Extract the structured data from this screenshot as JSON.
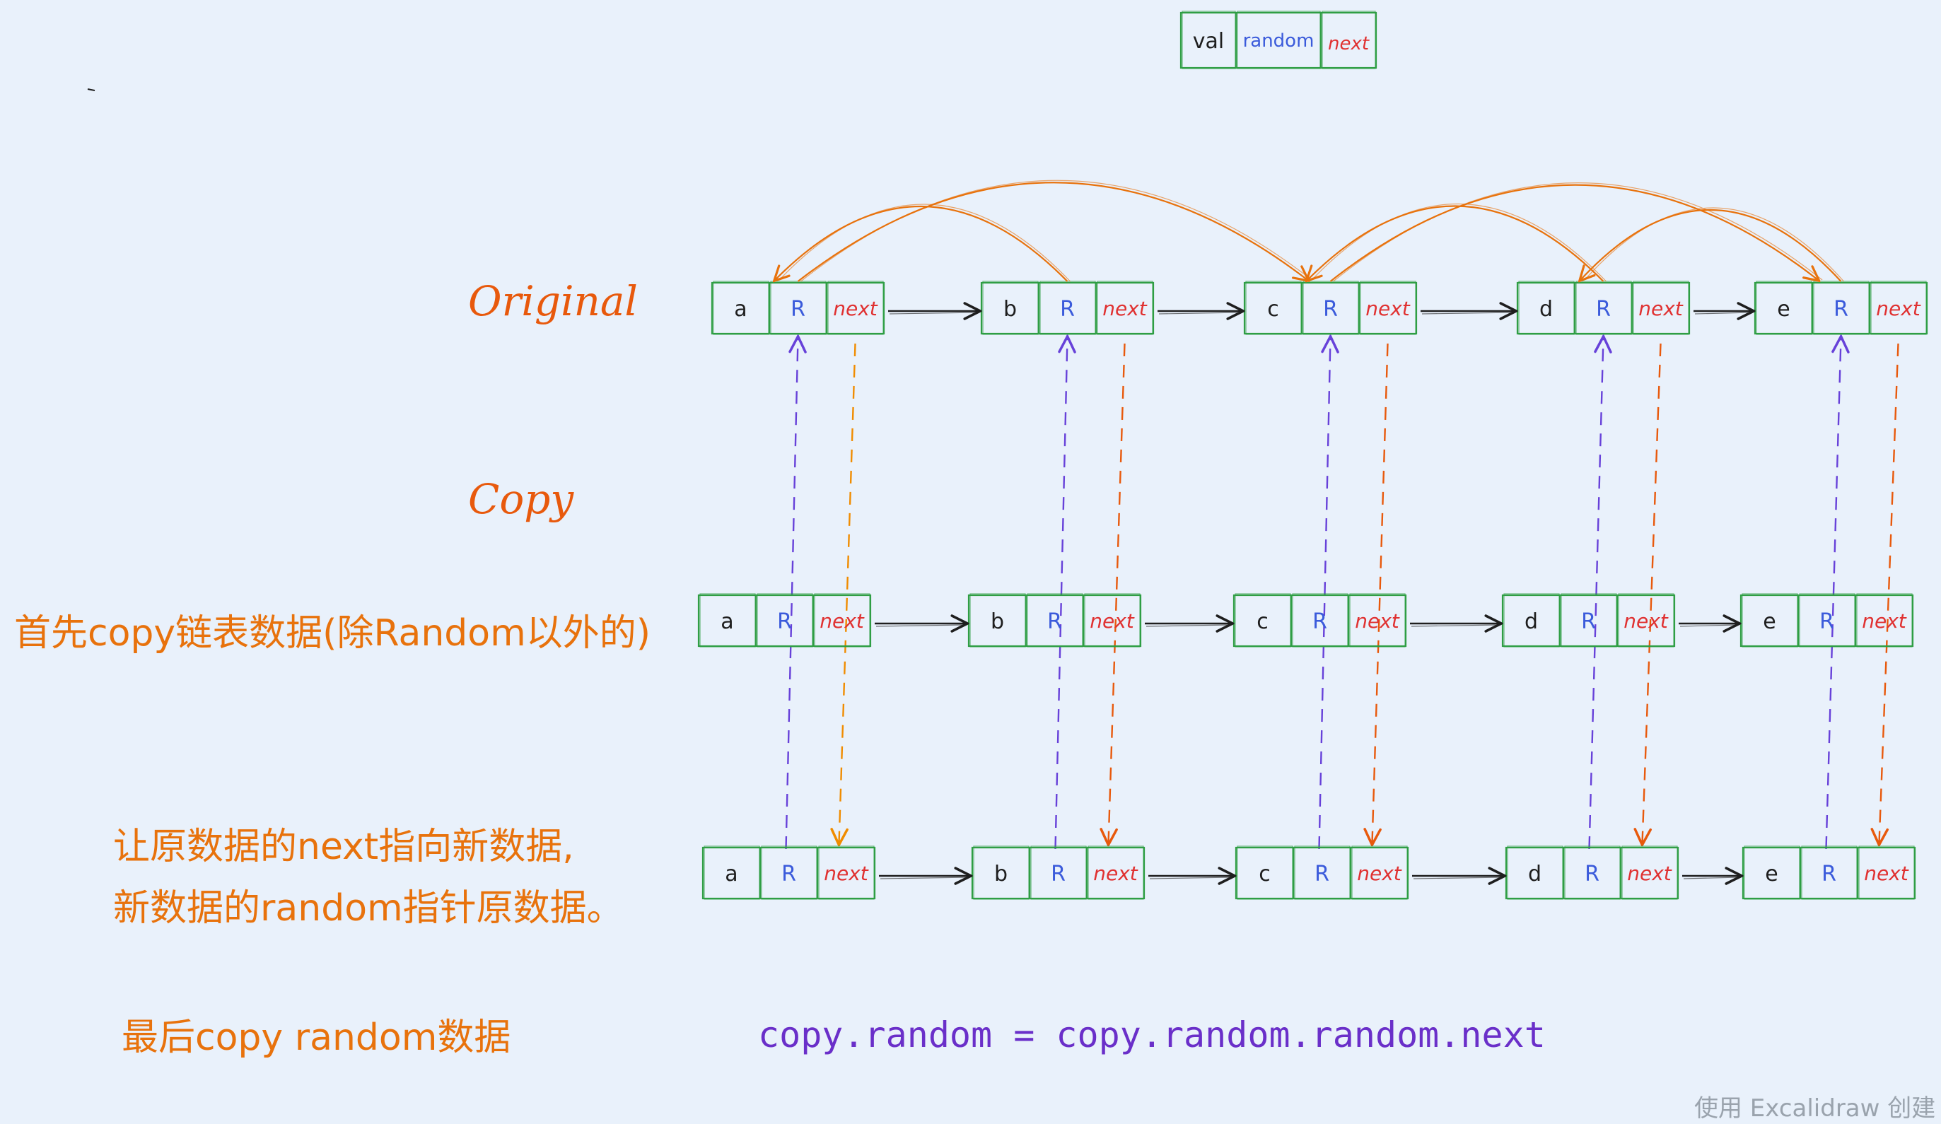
{
  "legend": {
    "val": "val",
    "random": "random",
    "next": "next"
  },
  "labels": {
    "original": "Original",
    "copy": "Copy",
    "step1": "首先copy链表数据(除Random以外的)",
    "step2_line1": "让原数据的next指向新数据,",
    "step2_line2": "新数据的random指针原数据。",
    "step3": "最后copy random数据",
    "formula": "copy.random = copy.random.random.next",
    "watermark": "使用 Excalidraw 创建"
  },
  "nodes": {
    "vals": [
      "a",
      "b",
      "c",
      "d",
      "e"
    ],
    "random_label": "R",
    "next_label": "next"
  },
  "random_links": [
    [
      0,
      2
    ],
    [
      1,
      0
    ],
    [
      2,
      4
    ],
    [
      3,
      2
    ],
    [
      4,
      3
    ]
  ],
  "colors": {
    "box": "#2f9e44",
    "next_text": "#e03131",
    "random_text": "#3b5bdb",
    "val_text": "#1e1e1e",
    "random_arrow": "#e8720c",
    "next_arrow": "#1e1e1e",
    "down_purple": "#6741d9",
    "down_orange": "#f08c00",
    "down_red": "#e8590c",
    "label": "#e8720c",
    "formula": "#6a2fc9"
  }
}
